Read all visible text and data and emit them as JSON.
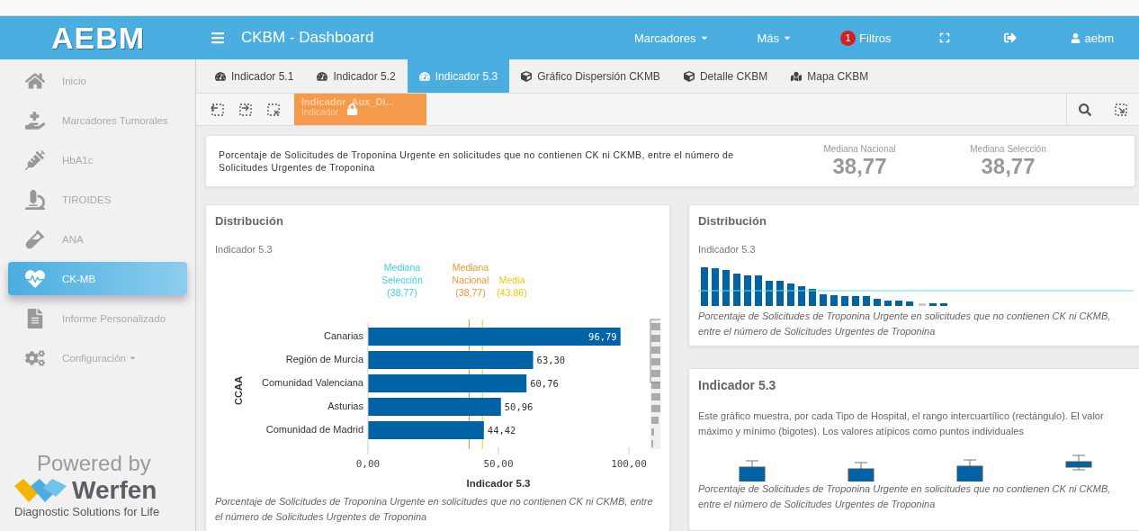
{
  "header": {
    "logo": "AEBM",
    "title": "CKBM - Dashboard",
    "menus": [
      {
        "label": "Marcadores"
      },
      {
        "label": "Más"
      }
    ],
    "filters": {
      "count": "1",
      "label": "Filtros"
    },
    "user": "aebm"
  },
  "sidebar": {
    "items": [
      {
        "label": "Inicio",
        "selected": false,
        "kind": "link"
      },
      {
        "label": "Marcadores Tumorales",
        "selected": false,
        "kind": "link"
      },
      {
        "label": "HbA1c",
        "selected": false,
        "kind": "link"
      },
      {
        "label": "TIROIDES",
        "selected": false,
        "kind": "link"
      },
      {
        "label": "ANA",
        "selected": false,
        "kind": "link"
      },
      {
        "label": "CK-MB",
        "selected": true,
        "kind": "link"
      },
      {
        "label": "Informe Personalizado",
        "selected": false,
        "kind": "link"
      },
      {
        "label": "Configuración",
        "selected": false,
        "kind": "menu"
      }
    ],
    "footer": {
      "powered": "Powered by",
      "brand": "Werfen",
      "tagline": "Diagnostic Solutions for Life"
    }
  },
  "tabs": [
    {
      "label": "Indicador 5.1",
      "selected": false
    },
    {
      "label": "Indicador 5.2",
      "selected": false
    },
    {
      "label": "Indicador 5.3",
      "selected": true
    },
    {
      "label": "Gráfico Dispersión CKMB",
      "selected": false
    },
    {
      "label": "Detalle CKBM",
      "selected": false
    },
    {
      "label": "Mapa CKBM",
      "selected": false
    }
  ],
  "toolbar": {
    "sheet": {
      "title": "Indicador_Aux_Di...",
      "subtitle": "Indicador",
      "locked": true
    }
  },
  "kpi": {
    "description": "Porcentaje de Solicitudes de Troponina Urgente en solicitudes que no contienen CK ni CKMB, entre el número de Solicitudes Urgentes de Troponina",
    "stats": [
      {
        "label": "Mediana Nacional",
        "value": "38,77"
      },
      {
        "label": "Mediana Selección",
        "value": "38,77"
      }
    ]
  },
  "distribution_panel": {
    "title": "Distribución",
    "subtitle": "Indicador 5.3",
    "footnote": "Porcentaje de Solicitudes de Troponina Urgente en solicitudes que no contienen CK ni CKMB, entre el número de Solicitudes Urgentes de Troponina",
    "chart_data": {
      "type": "bar",
      "orientation": "horizontal",
      "xlabel": "Indicador 5.3",
      "ylabel": "CCAA",
      "categories": [
        "Canarias",
        "Región de Murcia",
        "Comunidad Valenciana",
        "Asturias",
        "Comunidad de Madrid"
      ],
      "series": [
        {
          "color": "#0063a6",
          "values": [
            96.79,
            63.3,
            60.76,
            50.96,
            44.42
          ]
        }
      ],
      "value_labels": [
        "96,79",
        "63,30",
        "60,76",
        "50,96",
        "44,42"
      ],
      "xlim": [
        0,
        100
      ],
      "xticks": [
        {
          "value": 0,
          "label": "0,00"
        },
        {
          "value": 50,
          "label": "50,00"
        },
        {
          "value": 100,
          "label": "100,00"
        }
      ],
      "ref_lines": [
        {
          "axis": "x",
          "label": "Mediana Selección (38,77)",
          "value": 38.77,
          "color": "#33d6e0"
        },
        {
          "axis": "x",
          "label": "Mediana Nacional (38,77)",
          "value": 38.77,
          "color": "#f0962e"
        },
        {
          "axis": "x",
          "label": "Media (43,86)",
          "value": 43.86,
          "color": "#f5c800"
        }
      ]
    }
  },
  "mini_panel": {
    "title": "Distribución",
    "subtitle": "Indicador 5.3",
    "footnote": "Porcentaje de Solicitudes de Troponina Urgente en solicitudes que no contienen CK ni CKMB, entre el número de Solicitudes Urgentes de Troponina"
  },
  "boxplot_panel": {
    "title": "Indicador 5.3",
    "description": "Este gráfico muestra, por cada Tipo de Hospital, el rango intercuartílico (rectángulo). El valor máximo y mínimo (bigotes). Los valores atípicos como puntos individuales",
    "footnote": "Porcentaje de Solicitudes de Troponina Urgente en solicitudes que no contienen CK ni CKMB, entre el número de Solicitudes Urgentes de Troponina"
  }
}
